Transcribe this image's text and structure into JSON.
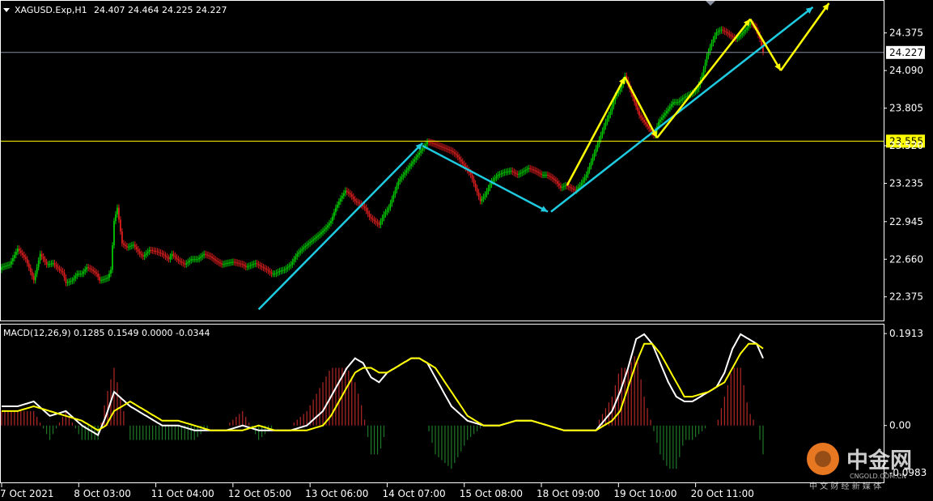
{
  "chart_data": [
    {
      "type": "candlestick",
      "symbol_header": "XAGUSD.Exp,H1",
      "ohlc_header": "24.407 24.464 24.225 24.227",
      "y_ticks": [
        "24.375",
        "24.090",
        "23.805",
        "23.520",
        "23.235",
        "22.945",
        "22.660",
        "22.375"
      ],
      "ylim": [
        22.22,
        24.6
      ],
      "x_ticks": [
        "7 Oct 2021",
        "8 Oct 03:00",
        "11 Oct 04:00",
        "12 Oct 05:00",
        "13 Oct 06:00",
        "14 Oct 07:00",
        "15 Oct 08:00",
        "18 Oct 09:00",
        "19 Oct 10:00",
        "20 Oct 11:00"
      ],
      "price_levels": [
        {
          "label": "24.227",
          "value": 24.227,
          "color": "#8a8fa0",
          "label_bg": "#ffffff",
          "label_fg": "#000000"
        },
        {
          "label": "23.555",
          "value": 23.555,
          "color": "#ffff00",
          "label_bg": "#ffff00",
          "label_fg": "#000000"
        }
      ],
      "colors": {
        "up": "#00c800",
        "down": "#dc1e1e",
        "arrow_trend": "#1ecbe1",
        "arrow_pattern": "#ffff00",
        "background": "#000000",
        "axis": "#ffffff"
      },
      "close_path": [
        [
          0,
          22.6
        ],
        [
          5,
          22.62
        ],
        [
          10,
          22.74
        ],
        [
          15,
          22.66
        ],
        [
          20,
          22.5
        ],
        [
          24,
          22.7
        ],
        [
          28,
          22.62
        ],
        [
          32,
          22.63
        ],
        [
          35,
          22.59
        ],
        [
          38,
          22.56
        ],
        [
          40,
          22.48
        ],
        [
          44,
          22.5
        ],
        [
          47,
          22.55
        ],
        [
          50,
          22.55
        ],
        [
          53,
          22.6
        ],
        [
          56,
          22.58
        ],
        [
          59,
          22.55
        ],
        [
          61,
          22.5
        ],
        [
          64,
          22.51
        ],
        [
          66,
          22.52
        ],
        [
          68,
          22.58
        ],
        [
          70,
          22.95
        ],
        [
          72,
          23.05
        ],
        [
          75,
          22.78
        ],
        [
          78,
          22.75
        ],
        [
          82,
          22.77
        ],
        [
          86,
          22.7
        ],
        [
          88,
          22.68
        ],
        [
          92,
          22.73
        ],
        [
          96,
          22.72
        ],
        [
          100,
          22.7
        ],
        [
          104,
          22.66
        ],
        [
          106,
          22.7
        ],
        [
          110,
          22.65
        ],
        [
          114,
          22.62
        ],
        [
          118,
          22.66
        ],
        [
          122,
          22.66
        ],
        [
          126,
          22.7
        ],
        [
          130,
          22.68
        ],
        [
          133,
          22.65
        ],
        [
          137,
          22.62
        ],
        [
          140,
          22.63
        ],
        [
          144,
          22.64
        ],
        [
          147,
          22.63
        ],
        [
          150,
          22.62
        ],
        [
          152,
          22.6
        ],
        [
          156,
          22.62
        ],
        [
          158,
          22.63
        ],
        [
          162,
          22.6
        ],
        [
          165,
          22.58
        ],
        [
          168,
          22.55
        ],
        [
          170,
          22.55
        ],
        [
          173,
          22.57
        ],
        [
          176,
          22.58
        ],
        [
          180,
          22.62
        ],
        [
          184,
          22.7
        ],
        [
          188,
          22.75
        ],
        [
          193,
          22.8
        ],
        [
          198,
          22.85
        ],
        [
          202,
          22.9
        ],
        [
          205,
          22.95
        ],
        [
          208,
          23.05
        ],
        [
          211,
          23.12
        ],
        [
          214,
          23.18
        ],
        [
          217,
          23.15
        ],
        [
          220,
          23.1
        ],
        [
          223,
          23.08
        ],
        [
          226,
          23.05
        ],
        [
          229,
          22.98
        ],
        [
          232,
          22.95
        ],
        [
          235,
          22.92
        ],
        [
          238,
          23.0
        ],
        [
          241,
          23.05
        ],
        [
          244,
          23.15
        ],
        [
          247,
          23.25
        ],
        [
          250,
          23.3
        ],
        [
          253,
          23.35
        ],
        [
          256,
          23.4
        ],
        [
          259,
          23.45
        ],
        [
          262,
          23.5
        ],
        [
          265,
          23.55
        ],
        [
          268,
          23.54
        ],
        [
          272,
          23.52
        ],
        [
          276,
          23.5
        ],
        [
          280,
          23.48
        ],
        [
          283,
          23.45
        ],
        [
          286,
          23.4
        ],
        [
          289,
          23.35
        ],
        [
          292,
          23.3
        ],
        [
          295,
          23.2
        ],
        [
          298,
          23.1
        ],
        [
          301,
          23.15
        ],
        [
          305,
          23.25
        ],
        [
          309,
          23.3
        ],
        [
          313,
          23.32
        ],
        [
          317,
          23.33
        ],
        [
          321,
          23.3
        ],
        [
          324,
          23.32
        ],
        [
          328,
          23.35
        ],
        [
          332,
          23.33
        ],
        [
          336,
          23.3
        ],
        [
          339,
          23.3
        ],
        [
          342,
          23.28
        ],
        [
          345,
          23.25
        ],
        [
          348,
          23.2
        ],
        [
          351,
          23.22
        ],
        [
          354,
          23.2
        ],
        [
          357,
          23.18
        ],
        [
          360,
          23.22
        ],
        [
          364,
          23.3
        ],
        [
          367,
          23.4
        ],
        [
          370,
          23.5
        ],
        [
          373,
          23.6
        ],
        [
          376,
          23.7
        ],
        [
          379,
          23.78
        ],
        [
          382,
          23.9
        ],
        [
          385,
          23.95
        ],
        [
          388,
          24.05
        ],
        [
          391,
          23.95
        ],
        [
          394,
          23.85
        ],
        [
          397,
          23.75
        ],
        [
          400,
          23.7
        ],
        [
          403,
          23.65
        ],
        [
          406,
          23.6
        ],
        [
          409,
          23.7
        ],
        [
          412,
          23.75
        ],
        [
          415,
          23.8
        ],
        [
          418,
          23.85
        ],
        [
          421,
          23.85
        ],
        [
          424,
          23.88
        ],
        [
          427,
          23.9
        ],
        [
          430,
          23.92
        ],
        [
          433,
          23.95
        ],
        [
          436,
          24.05
        ],
        [
          439,
          24.2
        ],
        [
          442,
          24.3
        ],
        [
          445,
          24.38
        ],
        [
          448,
          24.4
        ],
        [
          451,
          24.38
        ],
        [
          454,
          24.35
        ],
        [
          457,
          24.33
        ],
        [
          460,
          24.36
        ],
        [
          463,
          24.4
        ],
        [
          466,
          24.45
        ],
        [
          469,
          24.42
        ],
        [
          472,
          24.33
        ],
        [
          474,
          24.23
        ]
      ]
    },
    {
      "type": "line",
      "header": "MACD(12,26,9) 0.1285 0.1549 0.0000 -0.0344",
      "y_ticks": [
        "0.1913",
        "0.00",
        "-0.0983"
      ],
      "ylim": [
        -0.115,
        0.205
      ],
      "x": [
        0,
        10,
        20,
        30,
        40,
        50,
        60,
        65,
        70,
        80,
        90,
        100,
        110,
        120,
        130,
        140,
        150,
        160,
        170,
        180,
        190,
        200,
        205,
        210,
        215,
        220,
        225,
        230,
        235,
        240,
        250,
        255,
        260,
        265,
        270,
        280,
        290,
        300,
        310,
        320,
        330,
        340,
        350,
        360,
        370,
        380,
        385,
        390,
        395,
        400,
        405,
        410,
        415,
        420,
        425,
        430,
        440,
        445,
        450,
        455,
        460,
        465,
        470,
        474
      ],
      "series": [
        {
          "name": "MACD",
          "color": "#ffffff",
          "values": [
            0.04,
            0.04,
            0.05,
            0.02,
            0.03,
            0.0,
            -0.02,
            0.02,
            0.07,
            0.04,
            0.02,
            0.0,
            0.0,
            -0.01,
            -0.01,
            -0.01,
            0.0,
            -0.01,
            -0.01,
            -0.01,
            0.0,
            0.03,
            0.06,
            0.09,
            0.12,
            0.14,
            0.13,
            0.1,
            0.09,
            0.11,
            0.13,
            0.14,
            0.14,
            0.13,
            0.1,
            0.04,
            0.01,
            0.0,
            0.0,
            0.01,
            0.01,
            0.0,
            -0.01,
            -0.01,
            -0.01,
            0.03,
            0.07,
            0.12,
            0.18,
            0.19,
            0.17,
            0.13,
            0.09,
            0.06,
            0.05,
            0.05,
            0.07,
            0.08,
            0.11,
            0.16,
            0.19,
            0.18,
            0.17,
            0.14
          ]
        },
        {
          "name": "Signal",
          "color": "#ffff00",
          "values": [
            0.03,
            0.03,
            0.04,
            0.03,
            0.02,
            0.01,
            -0.01,
            0.0,
            0.03,
            0.05,
            0.03,
            0.01,
            0.01,
            0.0,
            -0.01,
            -0.01,
            -0.01,
            0.0,
            -0.01,
            -0.01,
            -0.01,
            0.0,
            0.02,
            0.05,
            0.08,
            0.11,
            0.12,
            0.12,
            0.11,
            0.11,
            0.13,
            0.14,
            0.14,
            0.13,
            0.12,
            0.07,
            0.02,
            0.0,
            0.0,
            0.01,
            0.01,
            0.0,
            -0.01,
            -0.01,
            -0.01,
            0.01,
            0.03,
            0.08,
            0.13,
            0.17,
            0.17,
            0.15,
            0.12,
            0.09,
            0.06,
            0.06,
            0.07,
            0.08,
            0.09,
            0.12,
            0.15,
            0.17,
            0.17,
            0.16
          ]
        }
      ]
    }
  ],
  "watermark": {
    "brand": "中金网",
    "domain": "CNGOLD.COM.CN",
    "tagline": "中 文 财 经 新 媒 体"
  }
}
